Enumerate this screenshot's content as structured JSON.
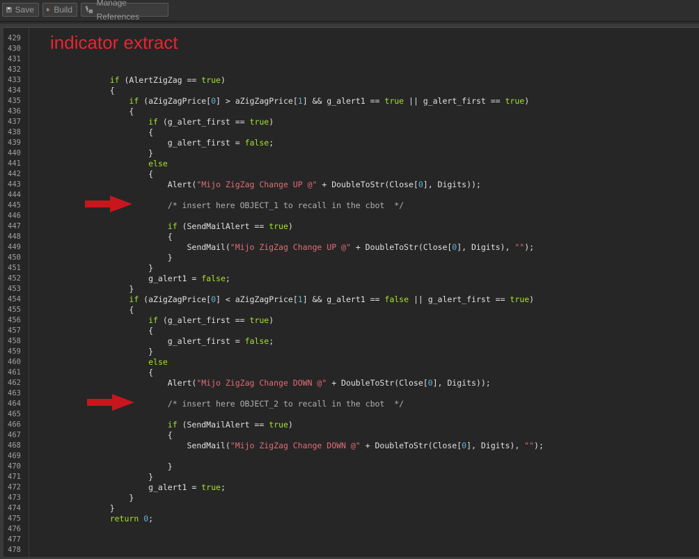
{
  "toolbar": {
    "save_label": "Save",
    "build_label": "Build",
    "manage_refs_label": "Manage References"
  },
  "annotation": {
    "title": "indicator extract",
    "title_color": "#e8252e",
    "arrow_color": "#c8161d"
  },
  "lines": [
    {
      "n": "429",
      "segs": []
    },
    {
      "n": "430",
      "segs": []
    },
    {
      "n": "431",
      "segs": []
    },
    {
      "n": "432",
      "segs": []
    },
    {
      "n": "433",
      "segs": [
        [
          "    ",
          ""
        ],
        [
          "if",
          "kw"
        ],
        [
          " (AlertZigZag == ",
          ""
        ],
        [
          "true",
          "kw"
        ],
        [
          ")",
          ""
        ]
      ]
    },
    {
      "n": "434",
      "segs": [
        [
          "    {",
          ""
        ]
      ]
    },
    {
      "n": "435",
      "segs": [
        [
          "        ",
          ""
        ],
        [
          "if",
          "kw"
        ],
        [
          " (aZigZagPrice[",
          ""
        ],
        [
          "0",
          "num"
        ],
        [
          "] > aZigZagPrice[",
          ""
        ],
        [
          "1",
          "num"
        ],
        [
          "] && g_alert1 == ",
          ""
        ],
        [
          "true",
          "kw"
        ],
        [
          " || g_alert_first == ",
          ""
        ],
        [
          "true",
          "kw"
        ],
        [
          ")",
          ""
        ]
      ]
    },
    {
      "n": "436",
      "segs": [
        [
          "        {",
          ""
        ]
      ]
    },
    {
      "n": "437",
      "segs": [
        [
          "            ",
          ""
        ],
        [
          "if",
          "kw"
        ],
        [
          " (g_alert_first == ",
          ""
        ],
        [
          "true",
          "kw"
        ],
        [
          ")",
          ""
        ]
      ]
    },
    {
      "n": "438",
      "segs": [
        [
          "            {",
          ""
        ]
      ]
    },
    {
      "n": "439",
      "segs": [
        [
          "                g_alert_first = ",
          ""
        ],
        [
          "false",
          "kw"
        ],
        [
          ";",
          ""
        ]
      ]
    },
    {
      "n": "440",
      "segs": [
        [
          "            }",
          ""
        ]
      ]
    },
    {
      "n": "441",
      "segs": [
        [
          "            ",
          ""
        ],
        [
          "else",
          "kw"
        ]
      ]
    },
    {
      "n": "442",
      "segs": [
        [
          "            {",
          ""
        ]
      ]
    },
    {
      "n": "443",
      "segs": [
        [
          "                Alert(",
          ""
        ],
        [
          "\"Mijo ZigZag Change UP @\"",
          "str"
        ],
        [
          " + DoubleToStr(Close[",
          ""
        ],
        [
          "0",
          "num"
        ],
        [
          "], Digits));",
          ""
        ]
      ]
    },
    {
      "n": "444",
      "segs": []
    },
    {
      "n": "445",
      "segs": [
        [
          "                ",
          ""
        ],
        [
          "/* insert here OBJECT_1 to recall in the cbot  */",
          "cmt"
        ]
      ]
    },
    {
      "n": "446",
      "segs": []
    },
    {
      "n": "447",
      "segs": [
        [
          "                ",
          ""
        ],
        [
          "if",
          "kw"
        ],
        [
          " (SendMailAlert == ",
          ""
        ],
        [
          "true",
          "kw"
        ],
        [
          ")",
          ""
        ]
      ]
    },
    {
      "n": "448",
      "segs": [
        [
          "                {",
          ""
        ]
      ]
    },
    {
      "n": "449",
      "segs": [
        [
          "                    SendMail(",
          ""
        ],
        [
          "\"Mijo ZigZag Change UP @\"",
          "str"
        ],
        [
          " + DoubleToStr(Close[",
          ""
        ],
        [
          "0",
          "num"
        ],
        [
          "], Digits), ",
          ""
        ],
        [
          "\"\"",
          "str"
        ],
        [
          ");",
          ""
        ]
      ]
    },
    {
      "n": "450",
      "segs": [
        [
          "                }",
          ""
        ]
      ]
    },
    {
      "n": "451",
      "segs": [
        [
          "            }",
          ""
        ]
      ]
    },
    {
      "n": "452",
      "segs": [
        [
          "            g_alert1 = ",
          ""
        ],
        [
          "false",
          "kw"
        ],
        [
          ";",
          ""
        ]
      ]
    },
    {
      "n": "453",
      "segs": [
        [
          "        }",
          ""
        ]
      ]
    },
    {
      "n": "454",
      "segs": [
        [
          "        ",
          ""
        ],
        [
          "if",
          "kw"
        ],
        [
          " (aZigZagPrice[",
          ""
        ],
        [
          "0",
          "num"
        ],
        [
          "] < aZigZagPrice[",
          ""
        ],
        [
          "1",
          "num"
        ],
        [
          "] && g_alert1 == ",
          ""
        ],
        [
          "false",
          "kw"
        ],
        [
          " || g_alert_first == ",
          ""
        ],
        [
          "true",
          "kw"
        ],
        [
          ")",
          ""
        ]
      ]
    },
    {
      "n": "455",
      "segs": [
        [
          "        {",
          ""
        ]
      ]
    },
    {
      "n": "456",
      "segs": [
        [
          "            ",
          ""
        ],
        [
          "if",
          "kw"
        ],
        [
          " (g_alert_first == ",
          ""
        ],
        [
          "true",
          "kw"
        ],
        [
          ")",
          ""
        ]
      ]
    },
    {
      "n": "457",
      "segs": [
        [
          "            {",
          ""
        ]
      ]
    },
    {
      "n": "458",
      "segs": [
        [
          "                g_alert_first = ",
          ""
        ],
        [
          "false",
          "kw"
        ],
        [
          ";",
          ""
        ]
      ]
    },
    {
      "n": "459",
      "segs": [
        [
          "            }",
          ""
        ]
      ]
    },
    {
      "n": "460",
      "segs": [
        [
          "            ",
          ""
        ],
        [
          "else",
          "kw"
        ]
      ]
    },
    {
      "n": "461",
      "segs": [
        [
          "            {",
          ""
        ]
      ]
    },
    {
      "n": "462",
      "segs": [
        [
          "                Alert(",
          ""
        ],
        [
          "\"Mijo ZigZag Change DOWN @\"",
          "str"
        ],
        [
          " + DoubleToStr(Close[",
          ""
        ],
        [
          "0",
          "num"
        ],
        [
          "], Digits));",
          ""
        ]
      ]
    },
    {
      "n": "463",
      "segs": []
    },
    {
      "n": "464",
      "segs": [
        [
          "                ",
          ""
        ],
        [
          "/* insert here OBJECT_2 to recall in the cbot  */",
          "cmt"
        ]
      ]
    },
    {
      "n": "465",
      "segs": []
    },
    {
      "n": "466",
      "segs": [
        [
          "                ",
          ""
        ],
        [
          "if",
          "kw"
        ],
        [
          " (SendMailAlert == ",
          ""
        ],
        [
          "true",
          "kw"
        ],
        [
          ")",
          ""
        ]
      ]
    },
    {
      "n": "467",
      "segs": [
        [
          "                {",
          ""
        ]
      ]
    },
    {
      "n": "468",
      "segs": [
        [
          "                    SendMail(",
          ""
        ],
        [
          "\"Mijo ZigZag Change DOWN @\"",
          "str"
        ],
        [
          " + DoubleToStr(Close[",
          ""
        ],
        [
          "0",
          "num"
        ],
        [
          "], Digits), ",
          ""
        ],
        [
          "\"\"",
          "str"
        ],
        [
          ");",
          ""
        ]
      ]
    },
    {
      "n": "469",
      "segs": []
    },
    {
      "n": "470",
      "segs": [
        [
          "                }",
          ""
        ]
      ]
    },
    {
      "n": "471",
      "segs": [
        [
          "            }",
          ""
        ]
      ]
    },
    {
      "n": "472",
      "segs": [
        [
          "            g_alert1 = ",
          ""
        ],
        [
          "true",
          "kw"
        ],
        [
          ";",
          ""
        ]
      ]
    },
    {
      "n": "473",
      "segs": [
        [
          "        }",
          ""
        ]
      ]
    },
    {
      "n": "474",
      "segs": [
        [
          "    }",
          ""
        ]
      ]
    },
    {
      "n": "475",
      "segs": [
        [
          "    ",
          ""
        ],
        [
          "return",
          "kw"
        ],
        [
          " ",
          ""
        ],
        [
          "0",
          "num"
        ],
        [
          ";",
          ""
        ]
      ]
    },
    {
      "n": "476",
      "segs": []
    },
    {
      "n": "477",
      "segs": []
    },
    {
      "n": "478",
      "segs": []
    }
  ]
}
